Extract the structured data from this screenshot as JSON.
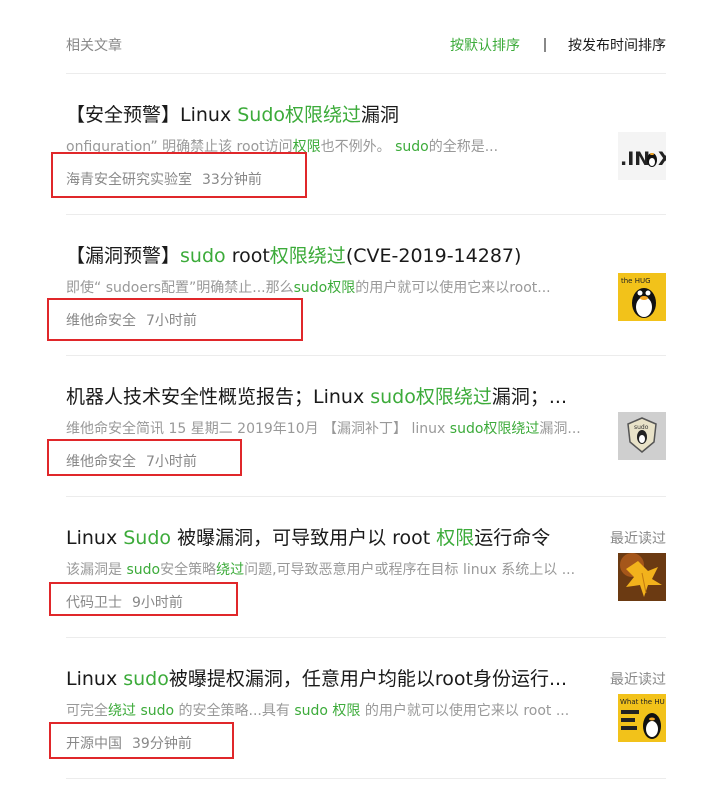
{
  "header": {
    "title": "相关文章",
    "sort_default": "按默认排序",
    "sort_time": "按发布时间排序"
  },
  "colors": {
    "accent": "#3cab3a",
    "annotation": "#e0272a"
  },
  "articles": [
    {
      "title_parts": [
        "【安全预警】Linux ",
        "Sudo权限绕过",
        "漏洞"
      ],
      "snippet_parts": [
        "onfiguration” 明确禁止该 root访问",
        "权限",
        "也不例外。 ",
        "sudo",
        "的全称是..."
      ],
      "source": "海青安全研究实验室",
      "time": "33分钟前",
      "thumb_icon": "linux-logo-thumbnail"
    },
    {
      "title_parts": [
        "【漏洞预警】",
        "sudo",
        " root",
        "权限绕过",
        "(CVE-2019-14287)"
      ],
      "snippet_parts": [
        "即使“ sudoers配置”明确禁止...那么",
        "sudo权限",
        "的用户就可以使用它来以root..."
      ],
      "source": "维他命安全",
      "time": "7小时前",
      "thumb_icon": "tux-penguin-thumbnail"
    },
    {
      "title_parts": [
        "机器人技术安全性概览报告；Linux ",
        "sudo权限绕过",
        "漏洞；..."
      ],
      "snippet_parts": [
        "维他命安全简讯 15 星期二 2019年10月 【漏洞补丁】 linux ",
        "sudo权限绕过",
        "漏洞..."
      ],
      "source": "维他命安全",
      "time": "7小时前",
      "thumb_icon": "sudo-badge-thumbnail"
    },
    {
      "title_parts": [
        "Linux ",
        "Sudo",
        " 被曝漏洞，可导致用户以 root ",
        "权限",
        "运行命令"
      ],
      "snippet_parts": [
        "该漏洞是 ",
        "sudo",
        "安全策略",
        "绕过",
        "问题,可导致恶意用户或程序在目标 linux 系统上以 ..."
      ],
      "source": "代码卫士",
      "time": "9小时前",
      "recent": "最近读过",
      "thumb_icon": "autumn-leaf-thumbnail"
    },
    {
      "title_parts": [
        "Linux ",
        "sudo",
        "被曝提权漏洞，任意用户均能以root身份运行..."
      ],
      "snippet_parts": [
        "可完全",
        "绕过",
        " ",
        "sudo",
        " 的安全策略...具有 ",
        "sudo",
        " ",
        "权限",
        " 的用户就可以使用它来以 root ..."
      ],
      "source": "开源中国",
      "time": "39分钟前",
      "recent": "最近读过",
      "thumb_icon": "meme-tux-thumbnail"
    }
  ]
}
